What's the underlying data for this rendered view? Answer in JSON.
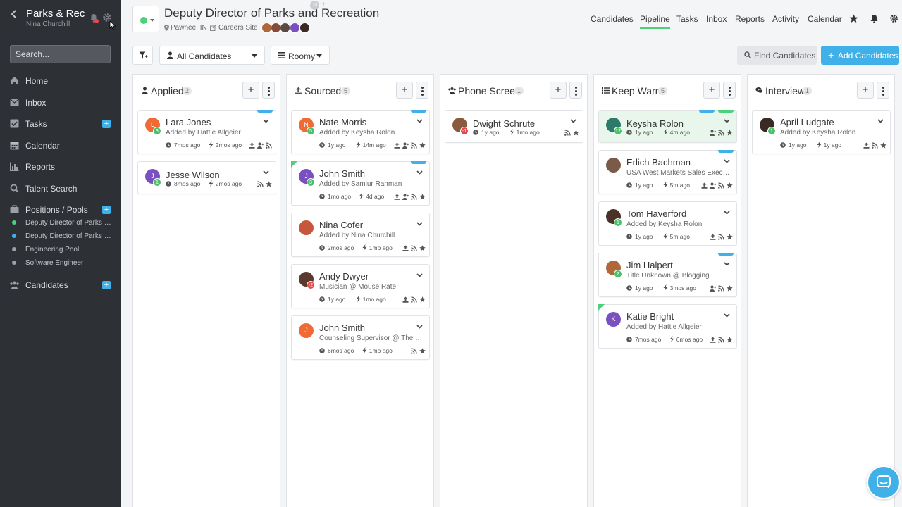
{
  "sidebar": {
    "org": "Parks & Rec",
    "user": "Nina Churchill",
    "search_placeholder": "Search...",
    "nav": [
      {
        "label": "Home",
        "icon": "home-icon"
      },
      {
        "label": "Inbox",
        "icon": "inbox-icon"
      },
      {
        "label": "Tasks",
        "icon": "tasks-icon",
        "plus": "+"
      },
      {
        "label": "Calendar",
        "icon": "calendar-icon"
      },
      {
        "label": "Reports",
        "icon": "reports-icon"
      },
      {
        "label": "Talent Search",
        "icon": "search-icon"
      },
      {
        "label": "Positions / Pools",
        "icon": "briefcase-icon",
        "plus": "+"
      },
      {
        "label": "Candidates",
        "icon": "users-icon",
        "plus": "+"
      }
    ],
    "positions": [
      {
        "label": "Deputy Director of Parks and Recreation",
        "color": "#4cd07a"
      },
      {
        "label": "Deputy Director of Parks and Recreation",
        "color": "#3fb1e8"
      },
      {
        "label": "Engineering Pool",
        "color": "#9ba0a8"
      },
      {
        "label": "Software Engineer",
        "color": "#9ba0a8"
      }
    ]
  },
  "header": {
    "title": "Deputy Director of Parks and Recreation",
    "location": "Pawnee, IN",
    "careers": "Careers Site",
    "team_more": "+3",
    "team_plus": "+",
    "nav": [
      "Candidates",
      "Pipeline",
      "Tasks",
      "Inbox",
      "Reports",
      "Activity",
      "Calendar"
    ],
    "active": "Pipeline"
  },
  "toolbar": {
    "candidates_filter": "All Candidates",
    "view": "Roomy",
    "find": "Find Candidates",
    "add": "Add Candidates",
    "add_plus": "+"
  },
  "columns": [
    {
      "title": "Applied",
      "count": "2",
      "icon": "user-icon",
      "cards": [
        {
          "name": "Lara Jones",
          "sub": "Added by Hattie Allgeier",
          "initial": "L",
          "color": "#f06a35",
          "badge": "3",
          "t1": "7mos ago",
          "t2": "2mos ago",
          "tag": true,
          "icons": [
            "upload-icon",
            "user-plus-icon",
            "rss-icon"
          ]
        },
        {
          "name": "Jesse Wilson",
          "sub": "",
          "initial": "J",
          "color": "#7a4fc0",
          "badge": "1",
          "t1": "8mos ago",
          "t2": "2mos ago",
          "icons": [
            "rss-icon",
            "star-icon"
          ]
        }
      ]
    },
    {
      "title": "Sourced",
      "count": "5",
      "icon": "upload-icon",
      "cards": [
        {
          "name": "Nate Morris",
          "sub": "Added by Keysha Rolon",
          "initial": "N",
          "color": "#f06a35",
          "badge": "5",
          "t1": "1y ago",
          "t2": "14m ago",
          "tag": true,
          "icons": [
            "upload-icon",
            "user-plus-icon",
            "rss-icon",
            "star-icon"
          ]
        },
        {
          "name": "John Smith",
          "sub": "Added by Samiur Rahman",
          "initial": "J",
          "color": "#7a4fc0",
          "badge": "3",
          "t1": "1mo ago",
          "t2": "4d ago",
          "tag": true,
          "corner": true,
          "icons": [
            "upload-icon",
            "user-plus-icon",
            "rss-icon",
            "star-icon"
          ]
        },
        {
          "name": "Nina Cofer",
          "sub": "Added by Nina Churchill",
          "initial": "",
          "color": "#c7573c",
          "badge": "",
          "t1": "2mos ago",
          "t2": "1mo ago",
          "icons": [
            "upload-icon",
            "rss-icon",
            "star-icon"
          ]
        },
        {
          "name": "Andy Dwyer",
          "sub": "Musician @ Mouse Rate",
          "initial": "",
          "color": "#5a3a2e",
          "badge": "-2",
          "badge_red": true,
          "t1": "1y ago",
          "t2": "1mo ago",
          "icons": [
            "upload-icon",
            "rss-icon",
            "star-icon"
          ]
        },
        {
          "name": "John Smith",
          "sub": "Counseling Supervisor @ The Western Reserve",
          "initial": "J",
          "color": "#f06a35",
          "badge": "",
          "t1": "6mos ago",
          "t2": "1mo ago",
          "icons": [
            "rss-icon",
            "star-icon"
          ]
        }
      ]
    },
    {
      "title": "Phone Screen",
      "count": "1",
      "icon": "group-icon",
      "cards": [
        {
          "name": "Dwight Schrute",
          "sub": "",
          "initial": "",
          "color": "#8a5a40",
          "badge": "-1",
          "badge_red": true,
          "t1": "1y ago",
          "t2": "1mo ago",
          "icons": [
            "rss-icon",
            "star-icon"
          ]
        }
      ]
    },
    {
      "title": "Keep Warm",
      "count": "5",
      "icon": "list-icon",
      "cards": [
        {
          "name": "Keysha Rolon",
          "sub": "",
          "initial": "",
          "color": "#2e7a6a",
          "badge": "12",
          "t1": "1y ago",
          "t2": "4m ago",
          "tag": true,
          "tag2": true,
          "hl": true,
          "icons": [
            "user-plus-icon",
            "rss-icon",
            "star-icon"
          ]
        },
        {
          "name": "Erlich Bachman",
          "sub": "USA West Markets Sales Executive",
          "initial": "",
          "color": "#7a5a48",
          "badge": "",
          "t1": "1y ago",
          "t2": "5m ago",
          "tag": true,
          "icons": [
            "upload-icon",
            "user-plus-icon",
            "rss-icon",
            "star-icon"
          ]
        },
        {
          "name": "Tom Haverford",
          "sub": "Added by Keysha Rolon",
          "initial": "",
          "color": "#4a3228",
          "badge": "1",
          "t1": "1y ago",
          "t2": "5m ago",
          "icons": [
            "upload-icon",
            "rss-icon",
            "star-icon"
          ]
        },
        {
          "name": "Jim Halpert",
          "sub": "Title Unknown @ Blogging",
          "initial": "",
          "color": "#b0683a",
          "badge": "2",
          "t1": "1y ago",
          "t2": "3mos ago",
          "tag": true,
          "icons": [
            "user-plus-icon",
            "rss-icon",
            "star-icon"
          ]
        },
        {
          "name": "Katie Bright",
          "sub": "Added by Hattie Allgeier",
          "initial": "K",
          "color": "#7a4fc0",
          "badge": "",
          "t1": "7mos ago",
          "t2": "6mos ago",
          "corner": true,
          "icons": [
            "upload-icon",
            "rss-icon",
            "star-icon"
          ]
        }
      ]
    },
    {
      "title": "Interview",
      "count": "1",
      "icon": "chat-icon",
      "cards": [
        {
          "name": "April Ludgate",
          "sub": "Added by Keysha Rolon",
          "initial": "",
          "color": "#3a2a24",
          "badge": "1",
          "t1": "1y ago",
          "t2": "1y ago",
          "icons": [
            "upload-icon",
            "rss-icon",
            "star-icon"
          ]
        }
      ]
    }
  ],
  "colors": {
    "accent": "#3fb1e8",
    "green": "#4cd07a",
    "sidebar": "#2d3035"
  }
}
